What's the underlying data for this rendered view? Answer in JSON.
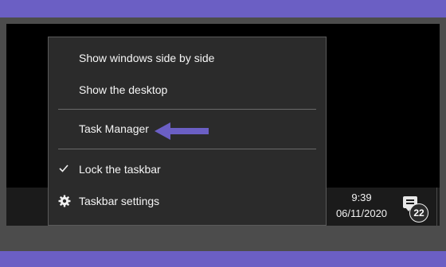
{
  "context_menu": {
    "items": [
      {
        "label": "Show windows side by side"
      },
      {
        "label": "Show the desktop"
      },
      {
        "label": "Task Manager"
      },
      {
        "label": "Lock the taskbar",
        "checked": true,
        "icon": "check-icon"
      },
      {
        "label": "Taskbar settings",
        "icon": "gear-icon"
      }
    ]
  },
  "taskbar": {
    "clock": {
      "time": "9:39",
      "date": "06/11/2020"
    },
    "notifications": {
      "count": "22",
      "icon": "action-center-icon"
    }
  },
  "annotation": {
    "arrow_color": "#6b5fc4",
    "points_to": "Task Manager"
  },
  "colors": {
    "frame_band": "#6b5fc4",
    "menu_bg": "#2b2b2b",
    "taskbar_bg": "#1b1b1b"
  }
}
